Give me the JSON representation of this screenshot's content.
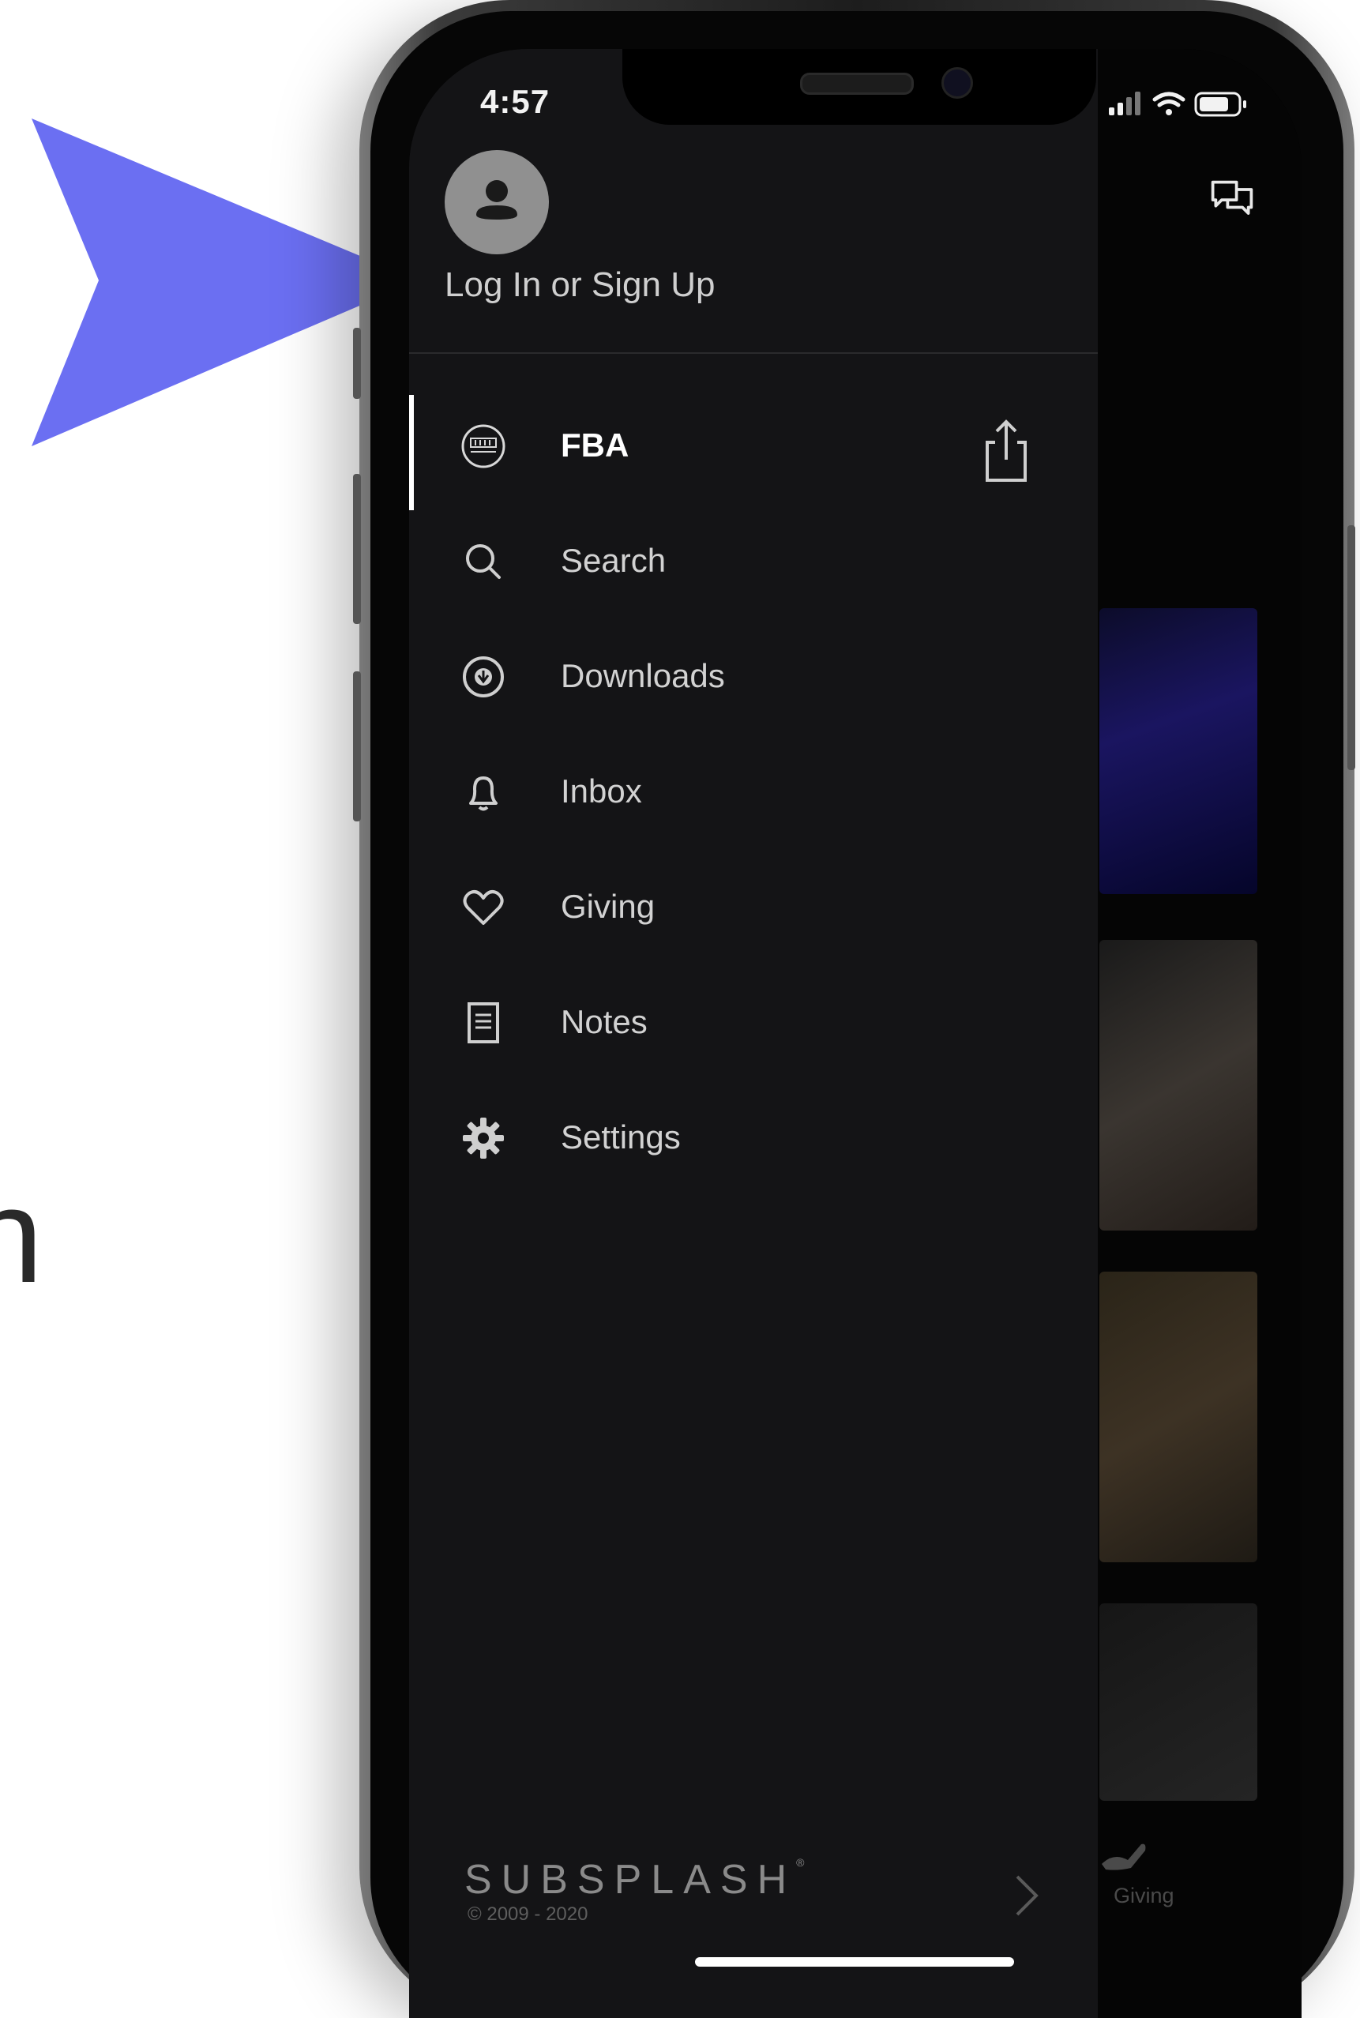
{
  "status_bar": {
    "time": "4:57"
  },
  "drawer": {
    "login_label": "Log In or Sign Up",
    "menu": [
      {
        "label": "FBA",
        "icon": "faith-logo-icon",
        "active": true
      },
      {
        "label": "Search",
        "icon": "search-icon"
      },
      {
        "label": "Downloads",
        "icon": "download-icon"
      },
      {
        "label": "Inbox",
        "icon": "bell-icon"
      },
      {
        "label": "Giving",
        "icon": "heart-icon"
      },
      {
        "label": "Notes",
        "icon": "notes-icon"
      },
      {
        "label": "Settings",
        "icon": "gear-icon"
      }
    ],
    "footer": {
      "brand": "SUBSPLASH",
      "copyright": "© 2009 - 2020"
    }
  },
  "background_app": {
    "tab_label": "Giving",
    "partial_text": "n"
  },
  "colors": {
    "pointer": "#6b6ff2",
    "drawer_bg": "#141416",
    "accent": "#ffffff"
  }
}
